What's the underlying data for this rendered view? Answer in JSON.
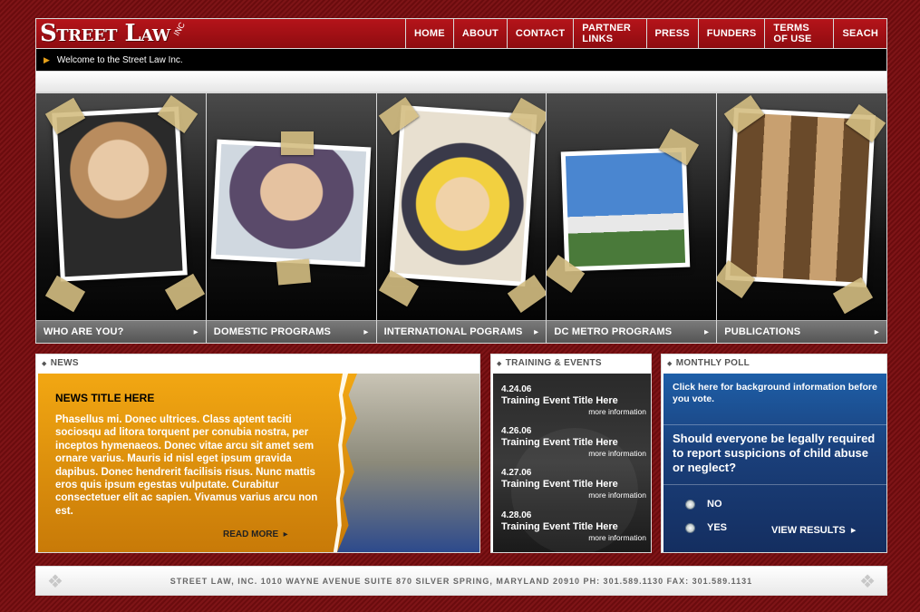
{
  "logo": {
    "main": "Street Law",
    "suffix": "INC"
  },
  "nav": [
    {
      "label": "HOME"
    },
    {
      "label": "ABOUT"
    },
    {
      "label": "CONTACT"
    },
    {
      "label": "PARTNER LINKS"
    },
    {
      "label": "PRESS"
    },
    {
      "label": "FUNDERS"
    },
    {
      "label": "TERMS OF USE"
    },
    {
      "label": "SEACH"
    }
  ],
  "welcome": "Welcome to the Street Law Inc.",
  "panels": [
    {
      "label": "WHO ARE YOU?"
    },
    {
      "label": "DOMESTIC PROGRAMS"
    },
    {
      "label": "INTERNATIONAL POGRAMS"
    },
    {
      "label": "DC METRO PROGRAMS"
    },
    {
      "label": "PUBLICATIONS"
    }
  ],
  "news": {
    "header": "NEWS",
    "title": "NEWS TITLE HERE",
    "text": "Phasellus mi. Donec ultrices. Class aptent taciti sociosqu ad litora torquent per conubia nostra, per inceptos hymenaeos. Donec vitae arcu sit amet sem ornare varius. Mauris id nisl eget ipsum gravida dapibus. Donec hendrerit facilisis risus. Nunc mattis eros quis ipsum egestas vulputate. Curabitur consectetuer elit ac sapien. Vivamus varius arcu non est.",
    "read_more": "READ MORE"
  },
  "events": {
    "header": "TRAINING & EVENTS",
    "items": [
      {
        "date": "4.24.06",
        "title": "Training Event Title Here",
        "more": "more information"
      },
      {
        "date": "4.26.06",
        "title": "Training Event Title Here",
        "more": "more information"
      },
      {
        "date": "4.27.06",
        "title": "Training Event Title Here",
        "more": "more information"
      },
      {
        "date": "4.28.06",
        "title": "Training Event Title Here",
        "more": "more information"
      }
    ]
  },
  "poll": {
    "header": "MONTHLY POLL",
    "info": "Click here for background information before you vote.",
    "question": "Should everyone be legally required to report suspicions of child abuse or neglect?",
    "options": [
      "NO",
      "YES"
    ],
    "view_results": "VIEW RESULTS"
  },
  "footer": "STREET LAW, INC.  1010 WAYNE AVENUE  SUITE 870  SILVER SPRING, MARYLAND 20910  PH: 301.589.1130  FAX: 301.589.1131",
  "colors": {
    "background": "#7a0d10",
    "header_red": "#b5141a",
    "news_orange": "#f2a712",
    "poll_blue": "#1a3f7a"
  }
}
